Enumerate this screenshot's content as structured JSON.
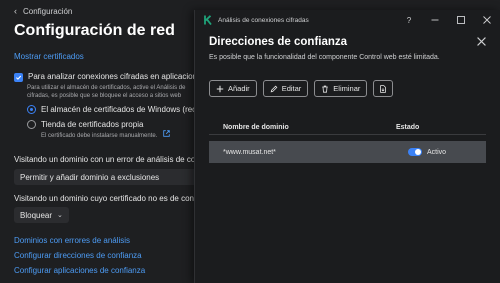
{
  "background": {
    "back_label": "Configuración",
    "page_title": "Configuración de red",
    "show_certs_link": "Mostrar certificados",
    "analyze_checkbox_label": "Para analizar conexiones cifradas en aplicaciones",
    "analyze_note_line1": "Para utilizar el almacén de certificados, active el Análisis de",
    "analyze_note_line2": "cifradas, es posible que se bloquee el acceso a sitios web",
    "radio_windows_label": "El almacén de certificados de Windows (recomendado)",
    "radio_own_label": "Tienda de certificados propia",
    "radio_own_note": "El certificado debe instalarse manualmente.",
    "untrusted_label": "Visitando un dominio con un error de análisis de conexiones",
    "untrusted_select": "Permitir y añadir dominio a exclusiones",
    "untrusted_cert_label": "Visitando un dominio cuyo certificado no es de confianza",
    "block_select": "Bloquear",
    "link_domains_errors": "Dominios con errores de análisis",
    "link_trusted_addresses": "Configurar direcciones de confianza",
    "link_trusted_apps": "Configurar aplicaciones de confianza"
  },
  "dialog": {
    "window_title": "Análisis de conexiones cifradas",
    "title": "Direcciones de confianza",
    "subtitle": "Es posible que la funcionalidad del componente Control web esté limitada.",
    "buttons": {
      "add": "Añadir",
      "edit": "Editar",
      "delete": "Eliminar"
    },
    "table": {
      "headers": [
        "Nombre de dominio",
        "Estado"
      ],
      "rows": [
        {
          "domain": "*www.musat.net*",
          "status": "Activo",
          "enabled": true
        }
      ]
    },
    "icons": {
      "logo": "kaspersky-k-icon",
      "help": "help-icon",
      "minimize": "minimize-icon",
      "maximize": "maximize-icon",
      "close": "close-icon"
    },
    "colors": {
      "accent": "#3b82f6",
      "link": "#4d9cf5",
      "logo": "#1fa37a",
      "selected_row": "#474a4f"
    }
  }
}
